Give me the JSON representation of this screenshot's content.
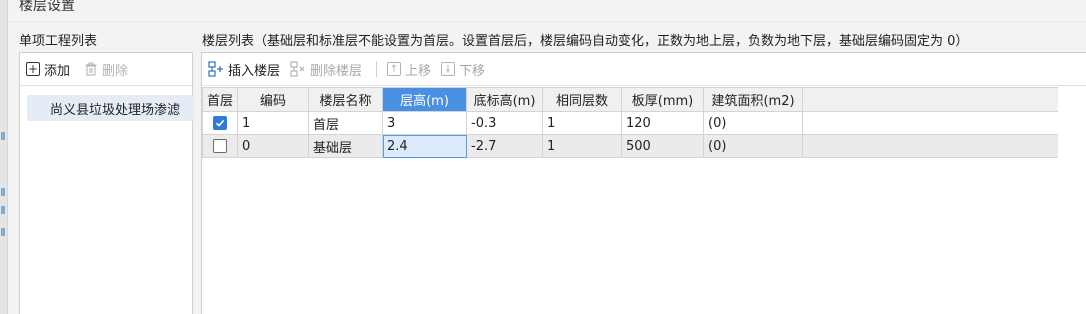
{
  "dialog": {
    "title": "楼层设置"
  },
  "left": {
    "header": "单项工程列表",
    "add_label": "添加",
    "delete_label": "删除",
    "items": [
      {
        "label": "尚义县垃圾处理场渗滤"
      }
    ]
  },
  "right": {
    "header": "楼层列表（基础层和标准层不能设置为首层。设置首层后，楼层编码自动变化，正数为地上层，负数为地下层，基础层编码固定为 0）",
    "toolbar": {
      "insert": "插入楼层",
      "delete": "删除楼层",
      "up": "上移",
      "down": "下移"
    },
    "columns": [
      "首层",
      "编码",
      "楼层名称",
      "层高(m)",
      "底标高(m)",
      "相同层数",
      "板厚(mm)",
      "建筑面积(m2)"
    ],
    "active_column": "层高(m)",
    "rows": [
      {
        "is_first": true,
        "code": "1",
        "name": "首层",
        "height": "3",
        "bottom": "-0.3",
        "same": "1",
        "thickness": "120",
        "area": "(0)"
      },
      {
        "is_first": false,
        "code": "0",
        "name": "基础层",
        "height": "2.4",
        "bottom": "-2.7",
        "same": "1",
        "thickness": "500",
        "area": "(0)"
      }
    ]
  },
  "colors": {
    "accent": "#4a90e2",
    "checkbox": "#2f7bd8",
    "selected_item": "#e5ecf6"
  }
}
